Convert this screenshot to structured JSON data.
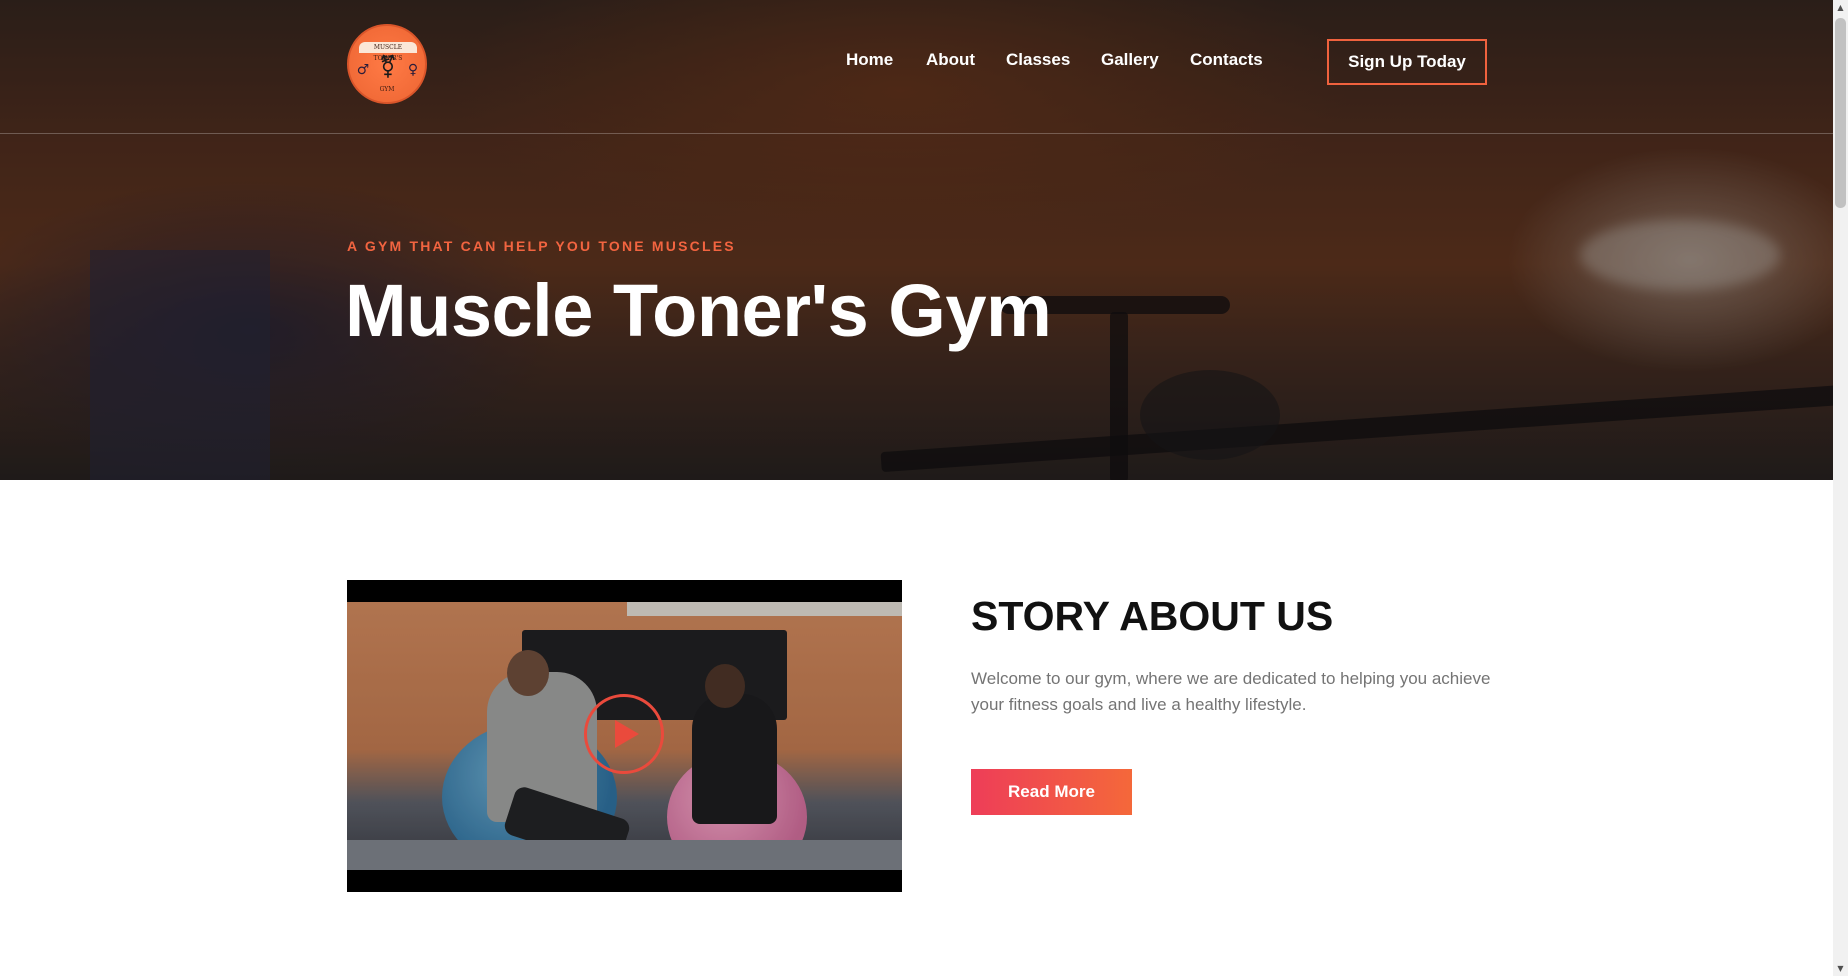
{
  "header": {
    "logo": {
      "band_text": "MUSCLE TONER'S",
      "sub_text": "GYM",
      "icon": "gender-symbol-icon"
    },
    "nav": [
      {
        "label": "Home"
      },
      {
        "label": "About"
      },
      {
        "label": "Classes"
      },
      {
        "label": "Gallery"
      },
      {
        "label": "Contacts"
      }
    ],
    "cta_label": "Sign Up Today"
  },
  "hero": {
    "tagline": "A GYM THAT CAN HELP YOU TONE MUSCLES",
    "title": "Muscle Toner's Gym"
  },
  "about": {
    "video": {
      "play_icon": "play-icon"
    },
    "title": "STORY ABOUT US",
    "text": "Welcome to our gym, where we are dedicated to helping you achieve your fitness goals and live a healthy lifestyle.",
    "button_label": "Read More"
  },
  "colors": {
    "accent": "#f26440",
    "button_gradient_start": "#ee3d58",
    "button_gradient_end": "#f4683a",
    "heading": "#111111",
    "body_text": "#747474"
  }
}
